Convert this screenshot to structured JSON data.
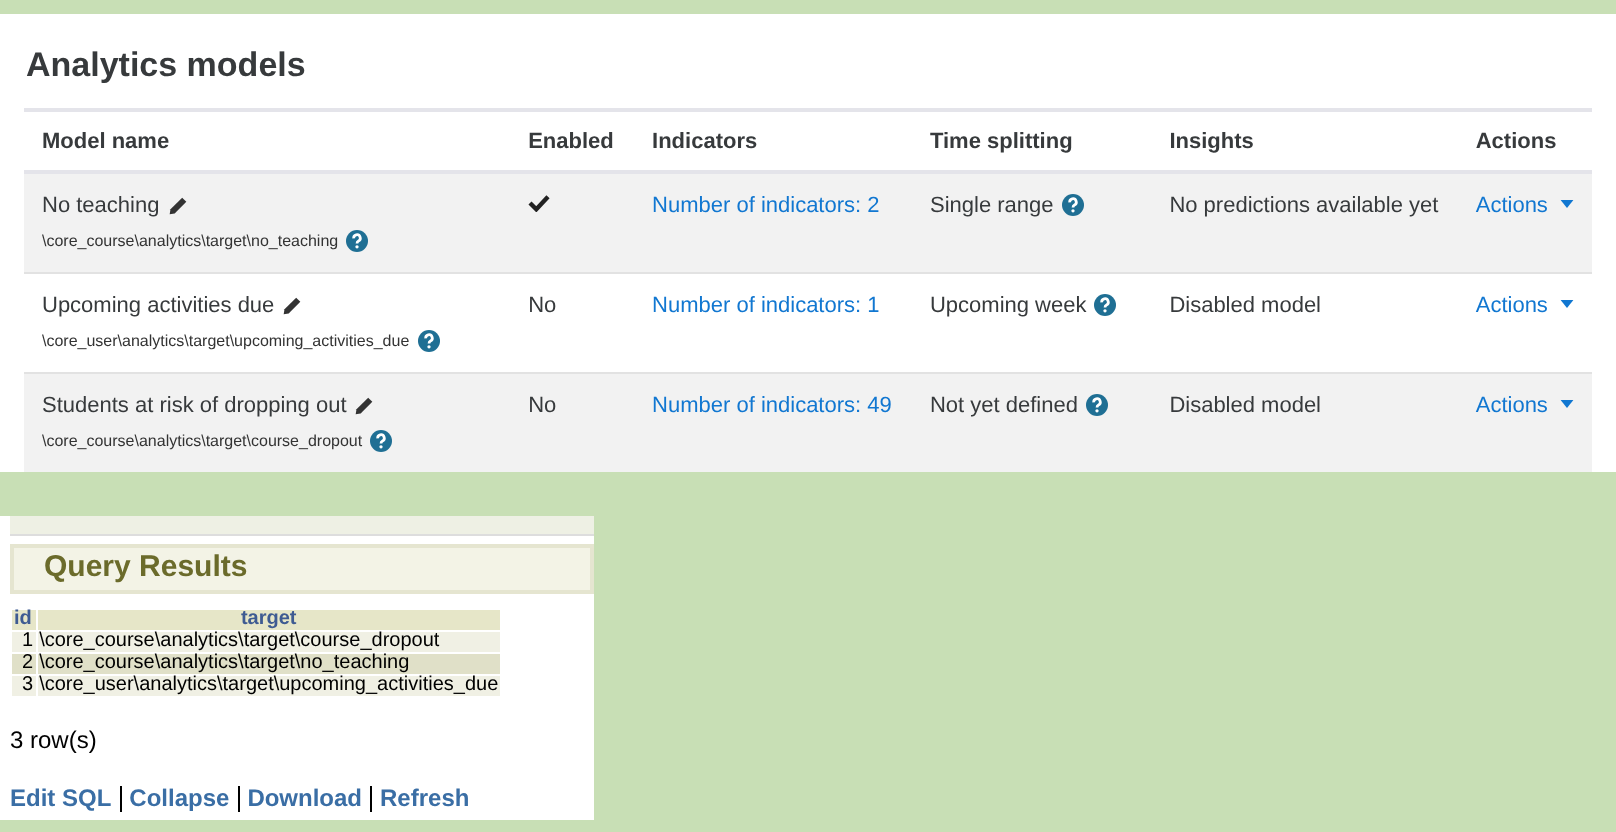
{
  "analytics": {
    "title": "Analytics models",
    "columns": [
      "Model name",
      "Enabled",
      "Indicators",
      "Time splitting",
      "Insights",
      "Actions"
    ],
    "rows": [
      {
        "name": "No teaching",
        "target": "\\core_course\\analytics\\target\\no_teaching",
        "enabled": true,
        "indicators": "Number of indicators: 2",
        "time_splitting": "Single range",
        "insights": "No predictions available yet",
        "actions": "Actions"
      },
      {
        "name": "Upcoming activities due",
        "target": "\\core_user\\analytics\\target\\upcoming_activities_due",
        "enabled": false,
        "enabled_text": "No",
        "indicators": "Number of indicators: 1",
        "time_splitting": "Upcoming week",
        "insights": "Disabled model",
        "actions": "Actions"
      },
      {
        "name": "Students at risk of dropping out",
        "target": "\\core_course\\analytics\\target\\course_dropout",
        "enabled": false,
        "enabled_text": "No",
        "indicators": "Number of indicators: 49",
        "time_splitting": "Not yet defined",
        "insights": "Disabled model",
        "actions": "Actions"
      }
    ]
  },
  "query": {
    "title": "Query Results",
    "columns": [
      "id",
      "target"
    ],
    "rows": [
      [
        "1",
        "\\core_course\\analytics\\target\\course_dropout"
      ],
      [
        "2",
        "\\core_course\\analytics\\target\\no_teaching"
      ],
      [
        "3",
        "\\core_user\\analytics\\target\\upcoming_activities_due"
      ]
    ],
    "row_count": "3 row(s)",
    "links": [
      "Edit SQL",
      "Collapse",
      "Download",
      "Refresh"
    ]
  }
}
